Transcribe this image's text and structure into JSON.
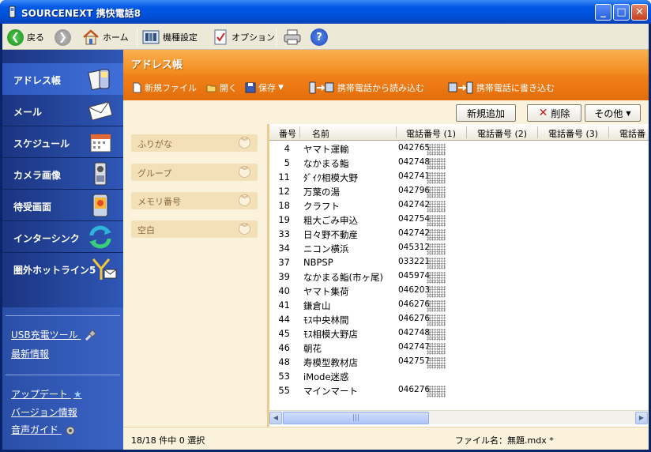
{
  "window": {
    "title": "SOURCENEXT 携快電話8",
    "min_icon": "minimize-icon",
    "max_icon": "maximize-icon",
    "close_icon": "close-icon"
  },
  "toolbar": {
    "back": "戻る",
    "home": "ホーム",
    "model_settings": "機種設定",
    "options": "オプション"
  },
  "sidebar": {
    "items": [
      {
        "label": "アドレス帳",
        "icon": "phone-book-icon"
      },
      {
        "label": "メール",
        "icon": "envelope-icon"
      },
      {
        "label": "スケジュール",
        "icon": "calendar-icon"
      },
      {
        "label": "カメラ画像",
        "icon": "camera-phone-icon"
      },
      {
        "label": "待受画面",
        "icon": "wallpaper-icon"
      },
      {
        "label": "インターシンク",
        "icon": "sync-icon"
      },
      {
        "label": "圏外ホットライン5",
        "icon": "antenna-mail-icon"
      }
    ],
    "links": [
      {
        "label": "USB充電ツール",
        "icon": "usb-plug-icon"
      },
      {
        "label": "最新情報"
      },
      {
        "label": "アップデート",
        "icon": "star-icon"
      },
      {
        "label": "バージョン情報"
      },
      {
        "label": "音声ガイド",
        "icon": "speaker-icon"
      }
    ]
  },
  "main": {
    "title": "アドレス帳",
    "actions": {
      "new_file": "新規ファイル",
      "open": "開く",
      "save": "保存",
      "read_from_phone": "携帯電話から読み込む",
      "write_to_phone": "携帯電話に書き込む"
    },
    "buttons": {
      "add_new": "新規追加",
      "delete": "削除",
      "other": "その他"
    },
    "filters": [
      "ふりがな",
      "グループ",
      "メモリ番号",
      "空白"
    ],
    "columns": {
      "no": "番号",
      "name": "名前",
      "phone1": "電話番号 (1)",
      "phone2": "電話番号 (2)",
      "phone3": "電話番号 (3)",
      "phone4": "電話番"
    },
    "rows": [
      {
        "no": "4",
        "name": "ヤマト運輸",
        "phone": "042765"
      },
      {
        "no": "5",
        "name": "なかまる鮨",
        "phone": "042748"
      },
      {
        "no": "11",
        "name": "ﾀﾞｲｸ相模大野",
        "phone": "042741"
      },
      {
        "no": "12",
        "name": "万葉の湯",
        "phone": "042796"
      },
      {
        "no": "18",
        "name": "クラフト",
        "phone": "042742"
      },
      {
        "no": "19",
        "name": "粗大ごみ申込",
        "phone": "042754"
      },
      {
        "no": "33",
        "name": "日々野不動産",
        "phone": "042742"
      },
      {
        "no": "34",
        "name": "ニコン横浜",
        "phone": "045312"
      },
      {
        "no": "37",
        "name": "NBPSP",
        "phone": "033221"
      },
      {
        "no": "39",
        "name": "なかまる鮨(市ヶ尾)",
        "phone": "045974"
      },
      {
        "no": "40",
        "name": "ヤマト集荷",
        "phone": "046203"
      },
      {
        "no": "41",
        "name": "鎌倉山",
        "phone": "046276"
      },
      {
        "no": "44",
        "name": "ﾓｽ中央林間",
        "phone": "046276"
      },
      {
        "no": "45",
        "name": "ﾓｽ相模大野店",
        "phone": "042748"
      },
      {
        "no": "46",
        "name": "朝花",
        "phone": "042747"
      },
      {
        "no": "48",
        "name": "寿模型教材店",
        "phone": "042757"
      },
      {
        "no": "53",
        "name": "iMode迷惑",
        "phone": ""
      },
      {
        "no": "55",
        "name": "マインマート",
        "phone": "046276"
      }
    ],
    "status": {
      "count": "18/18 件中 0 選択",
      "file": "ファイル名：無題.mdx *"
    }
  }
}
